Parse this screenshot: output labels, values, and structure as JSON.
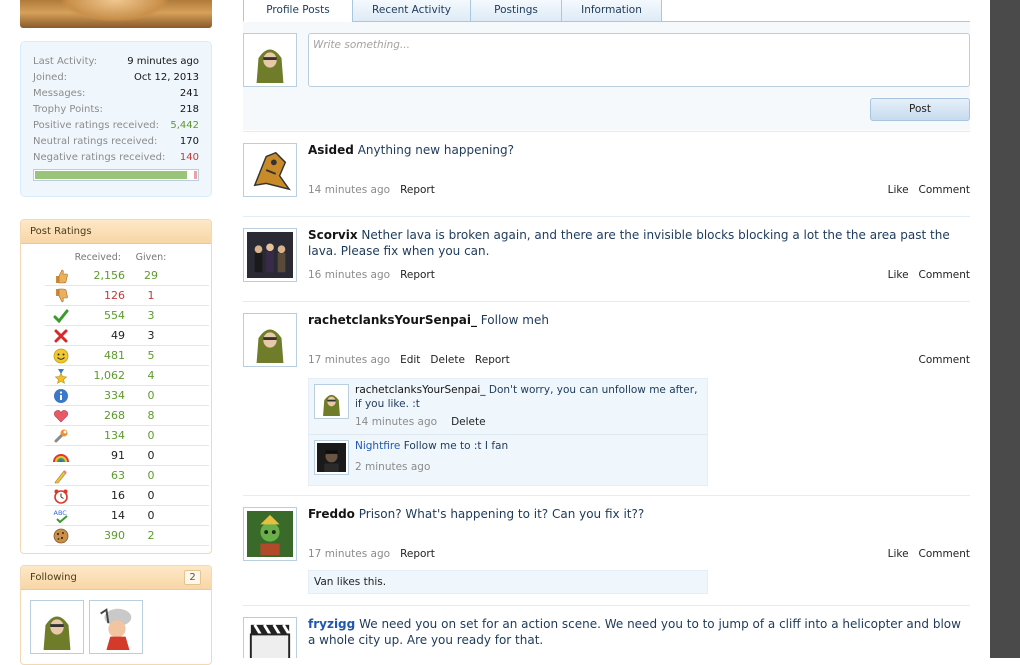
{
  "colors": {
    "accent": "#1d3a5a",
    "positive": "#5c9a2c",
    "negative": "#c23a3a",
    "tab_border": "#a9c8e0"
  },
  "profile_stats": [
    {
      "label": "Last Activity:",
      "value": "9 minutes ago",
      "tone": "normal"
    },
    {
      "label": "Joined:",
      "value": "Oct 12, 2013",
      "tone": "normal"
    },
    {
      "label": "Messages:",
      "value": "241",
      "tone": "normal"
    },
    {
      "label": "Trophy Points:",
      "value": "218",
      "tone": "normal"
    },
    {
      "label": "Positive ratings received:",
      "value": "5,442",
      "tone": "pos"
    },
    {
      "label": "Neutral ratings received:",
      "value": "170",
      "tone": "normal"
    },
    {
      "label": "Negative ratings received:",
      "value": "140",
      "tone": "neg"
    }
  ],
  "rating_bar": {
    "positive_fraction": 0.95,
    "negative_fraction": 0.02
  },
  "post_ratings": {
    "title": "Post Ratings",
    "received_label": "Received:",
    "given_label": "Given:",
    "rows": [
      {
        "icon": "thumbs-up-icon",
        "received": "2,156",
        "given": "29",
        "tone": "green"
      },
      {
        "icon": "thumbs-down-icon",
        "received": "126",
        "given": "1",
        "tone": "red"
      },
      {
        "icon": "check-icon",
        "received": "554",
        "given": "3",
        "tone": "green"
      },
      {
        "icon": "cross-icon",
        "received": "49",
        "given": "3",
        "tone": "black"
      },
      {
        "icon": "smiley-icon",
        "received": "481",
        "given": "5",
        "tone": "green"
      },
      {
        "icon": "star-medal-icon",
        "received": "1,062",
        "given": "4",
        "tone": "green"
      },
      {
        "icon": "info-icon",
        "received": "334",
        "given": "0",
        "tone": "green"
      },
      {
        "icon": "heart-icon",
        "received": "268",
        "given": "8",
        "tone": "green"
      },
      {
        "icon": "wrench-icon",
        "received": "134",
        "given": "0",
        "tone": "green"
      },
      {
        "icon": "rainbow-icon",
        "received": "91",
        "given": "0",
        "tone": "black"
      },
      {
        "icon": "pencil-icon",
        "received": "63",
        "given": "0",
        "tone": "green"
      },
      {
        "icon": "alarm-clock-icon",
        "received": "16",
        "given": "0",
        "tone": "black"
      },
      {
        "icon": "spellcheck-icon",
        "received": "14",
        "given": "0",
        "tone": "black"
      },
      {
        "icon": "cookie-icon",
        "received": "390",
        "given": "2",
        "tone": "green"
      }
    ]
  },
  "following": {
    "title": "Following",
    "count": "2"
  },
  "tabs": [
    {
      "label": "Profile Posts",
      "active": true
    },
    {
      "label": "Recent Activity",
      "active": false
    },
    {
      "label": "Postings",
      "active": false
    },
    {
      "label": "Information",
      "active": false
    }
  ],
  "composer": {
    "placeholder": "Write something...",
    "post_label": "Post"
  },
  "posts": [
    {
      "author": "Asided",
      "text": "Anything new happening?",
      "time": "14 minutes ago",
      "left_actions": [
        "Report"
      ],
      "right_actions": [
        "Like",
        "Comment"
      ]
    },
    {
      "author": "Scorvix",
      "text": "Nether lava is broken again, and there are the invisible blocks blocking a lot the the area past the lava. Please fix when you can.",
      "time": "16 minutes ago",
      "left_actions": [
        "Report"
      ],
      "right_actions": [
        "Like",
        "Comment"
      ]
    },
    {
      "author": "rachetclanksYourSenpai_",
      "text": "Follow meh",
      "time": "17 minutes ago",
      "left_actions": [
        "Edit",
        "Delete",
        "Report"
      ],
      "right_actions": [
        "Comment"
      ],
      "comments": [
        {
          "author": "rachetclanksYourSenpai_",
          "text": "Don't worry, you can unfollow me after, if you like. :t",
          "time": "14 minutes ago",
          "actions": [
            "Delete"
          ]
        },
        {
          "author": "Nightfire",
          "text": "Follow me to :t I fan",
          "time": "2 minutes ago",
          "actions": []
        }
      ]
    },
    {
      "author": "Freddo",
      "text": "Prison? What's happening to it? Can you fix it??",
      "time": "17 minutes ago",
      "left_actions": [
        "Report"
      ],
      "right_actions": [
        "Like",
        "Comment"
      ],
      "likes": "Van likes this."
    },
    {
      "author": "fryzigg",
      "text": "We need you on set for an action scene. We need you to to jump of a cliff into a helicopter and blow a whole city up. Are you ready for that."
    }
  ]
}
